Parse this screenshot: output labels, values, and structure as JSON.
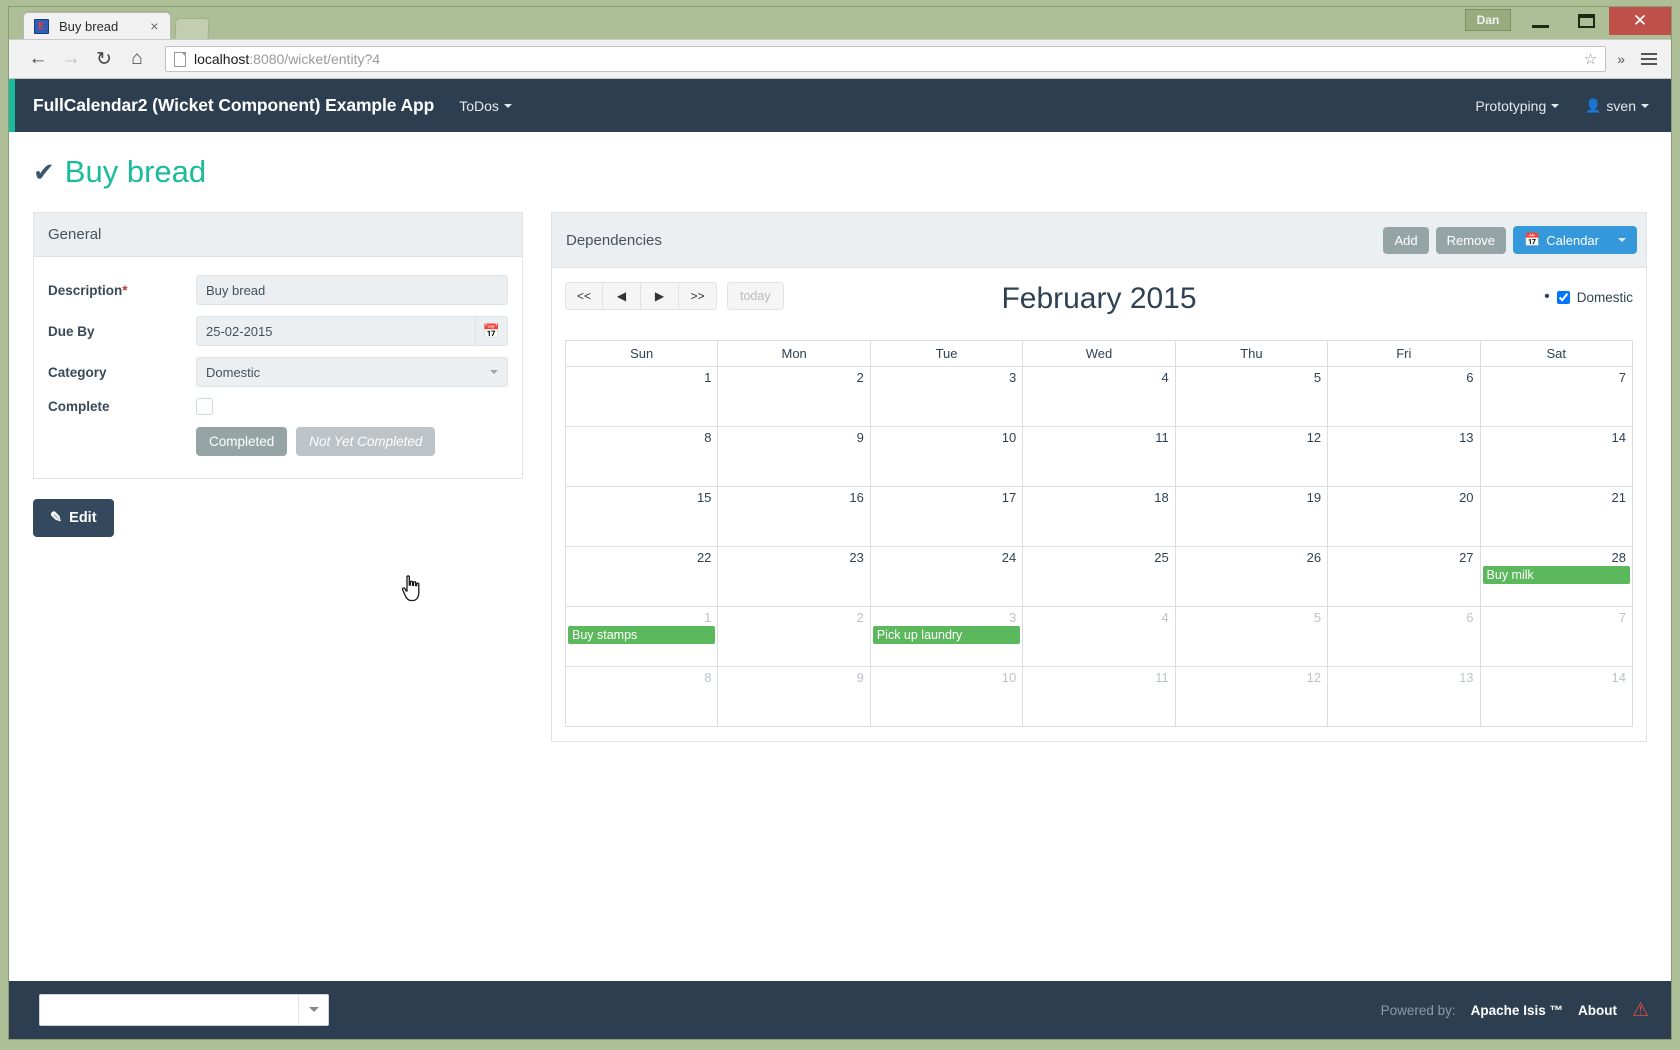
{
  "window": {
    "title_tab": "Buy bread",
    "favicon_letter": "E",
    "tab_close": "×",
    "dan_button": "Dan",
    "close_glyph": "✕"
  },
  "browser": {
    "back_icon": "←",
    "forward_icon": "→",
    "reload_icon": "↻",
    "home_icon": "⌂",
    "url_host": "localhost",
    "url_rest": ":8080/wicket/entity?4",
    "star_icon": "☆",
    "overflow_icon": "»"
  },
  "navbar": {
    "brand": "FullCalendar2 (Wicket Component) Example App",
    "menu": [
      {
        "label": "ToDos",
        "caret": true
      }
    ],
    "right": [
      {
        "label": "Prototyping",
        "caret": true
      },
      {
        "label": "sven",
        "caret": true,
        "icon": "user-icon"
      }
    ],
    "user_glyph": "👤"
  },
  "page": {
    "title": "Buy bread",
    "title_icon": "✔"
  },
  "general_panel": {
    "heading": "General",
    "fields": {
      "description_label": "Description",
      "description_required": "*",
      "description_value": "Buy bread",
      "dueby_label": "Due By",
      "dueby_value": "25-02-2015",
      "dueby_icon": "📅",
      "category_label": "Category",
      "category_value": "Domestic",
      "complete_label": "Complete"
    },
    "buttons": {
      "completed": "Completed",
      "not_yet_completed": "Not Yet Completed"
    }
  },
  "edit_button": {
    "label": "Edit",
    "icon": "✎"
  },
  "dependencies_panel": {
    "heading": "Dependencies",
    "add_label": "Add",
    "remove_label": "Remove",
    "calendar_label": "Calendar",
    "calendar_icon": "📅"
  },
  "calendar": {
    "nav": {
      "prev_year": "<<",
      "prev": "◀",
      "next": "▶",
      "next_year": ">>",
      "today": "today"
    },
    "title": "February 2015",
    "legend": {
      "bullet": "•",
      "label": "Domestic",
      "checked": true
    },
    "weekdays": [
      "Sun",
      "Mon",
      "Tue",
      "Wed",
      "Thu",
      "Fri",
      "Sat"
    ],
    "weeks": [
      [
        {
          "day": "1",
          "other": false,
          "today": false,
          "events": []
        },
        {
          "day": "2",
          "other": false,
          "today": false,
          "events": []
        },
        {
          "day": "3",
          "other": false,
          "today": false,
          "events": []
        },
        {
          "day": "4",
          "other": false,
          "today": false,
          "events": []
        },
        {
          "day": "5",
          "other": false,
          "today": false,
          "events": []
        },
        {
          "day": "6",
          "other": false,
          "today": false,
          "events": []
        },
        {
          "day": "7",
          "other": false,
          "today": false,
          "events": []
        }
      ],
      [
        {
          "day": "8",
          "other": false,
          "today": false,
          "events": []
        },
        {
          "day": "9",
          "other": false,
          "today": false,
          "events": []
        },
        {
          "day": "10",
          "other": false,
          "today": false,
          "events": []
        },
        {
          "day": "11",
          "other": false,
          "today": false,
          "events": []
        },
        {
          "day": "12",
          "other": false,
          "today": false,
          "events": []
        },
        {
          "day": "13",
          "other": false,
          "today": false,
          "events": []
        },
        {
          "day": "14",
          "other": false,
          "today": false,
          "events": []
        }
      ],
      [
        {
          "day": "15",
          "other": false,
          "today": false,
          "events": []
        },
        {
          "day": "16",
          "other": false,
          "today": false,
          "events": []
        },
        {
          "day": "17",
          "other": false,
          "today": false,
          "events": []
        },
        {
          "day": "18",
          "other": false,
          "today": false,
          "events": []
        },
        {
          "day": "19",
          "other": false,
          "today": false,
          "events": []
        },
        {
          "day": "20",
          "other": false,
          "today": false,
          "events": []
        },
        {
          "day": "21",
          "other": false,
          "today": false,
          "events": []
        }
      ],
      [
        {
          "day": "22",
          "other": false,
          "today": false,
          "events": []
        },
        {
          "day": "23",
          "other": false,
          "today": false,
          "events": []
        },
        {
          "day": "24",
          "other": false,
          "today": false,
          "events": []
        },
        {
          "day": "25",
          "other": false,
          "today": false,
          "events": []
        },
        {
          "day": "26",
          "other": false,
          "today": true,
          "events": []
        },
        {
          "day": "27",
          "other": false,
          "today": false,
          "events": []
        },
        {
          "day": "28",
          "other": false,
          "today": false,
          "events": [
            "Buy milk"
          ]
        }
      ],
      [
        {
          "day": "1",
          "other": true,
          "today": false,
          "events": [
            "Buy stamps"
          ]
        },
        {
          "day": "2",
          "other": true,
          "today": false,
          "events": []
        },
        {
          "day": "3",
          "other": true,
          "today": false,
          "events": [
            "Pick up laundry"
          ]
        },
        {
          "day": "4",
          "other": true,
          "today": false,
          "events": []
        },
        {
          "day": "5",
          "other": true,
          "today": false,
          "events": []
        },
        {
          "day": "6",
          "other": true,
          "today": false,
          "events": []
        },
        {
          "day": "7",
          "other": true,
          "today": false,
          "events": []
        }
      ],
      [
        {
          "day": "8",
          "other": true,
          "today": false,
          "events": []
        },
        {
          "day": "9",
          "other": true,
          "today": false,
          "events": []
        },
        {
          "day": "10",
          "other": true,
          "today": false,
          "events": []
        },
        {
          "day": "11",
          "other": true,
          "today": false,
          "events": []
        },
        {
          "day": "12",
          "other": true,
          "today": false,
          "events": []
        },
        {
          "day": "13",
          "other": true,
          "today": false,
          "events": []
        },
        {
          "day": "14",
          "other": true,
          "today": false,
          "events": []
        }
      ]
    ]
  },
  "footer": {
    "select_value": "",
    "powered_by": "Powered by:",
    "isis": "Apache Isis ™",
    "about": "About",
    "warning_icon": "⚠"
  },
  "colors": {
    "navbar": "#2c3e50",
    "accent_teal": "#1abc9c",
    "event_green": "#5cb85c",
    "today_yellow": "#fcf8d7",
    "primary_blue": "#3498db",
    "gray_btn": "#95a5a6"
  }
}
